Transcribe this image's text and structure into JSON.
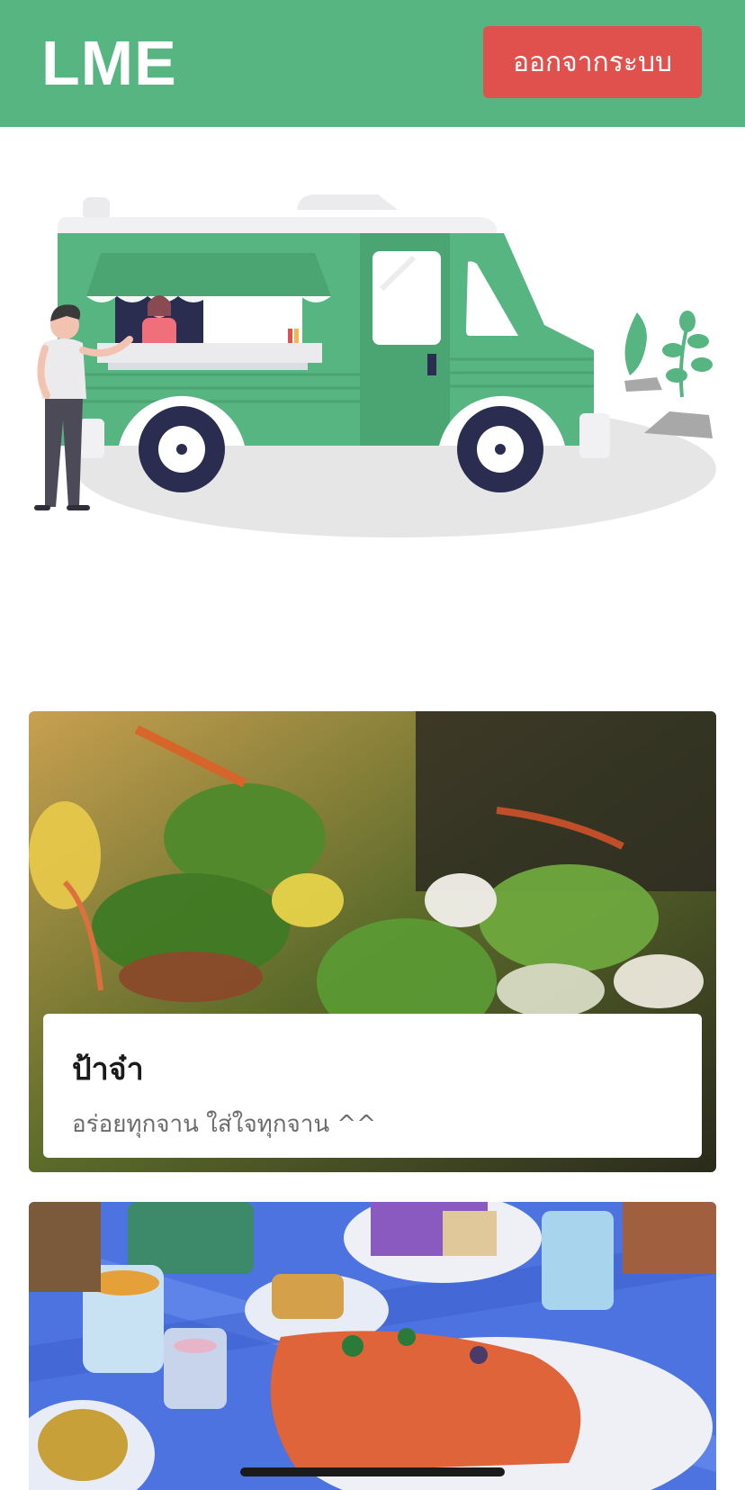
{
  "header": {
    "logo": "LME",
    "logout_label": "ออกจากระบบ",
    "background_color": "#56b581",
    "logout_color": "#e0504c"
  },
  "hero": {
    "illustration": "food-truck-illustration"
  },
  "restaurants": [
    {
      "name": "ป้าจ๋า",
      "description": "อร่อยทุกจาน ใส่ใจทุกจาน ^^",
      "image": "stir-fried-beef-broccoli-photo"
    },
    {
      "image": "illustrated-dinner-table-photo"
    }
  ]
}
